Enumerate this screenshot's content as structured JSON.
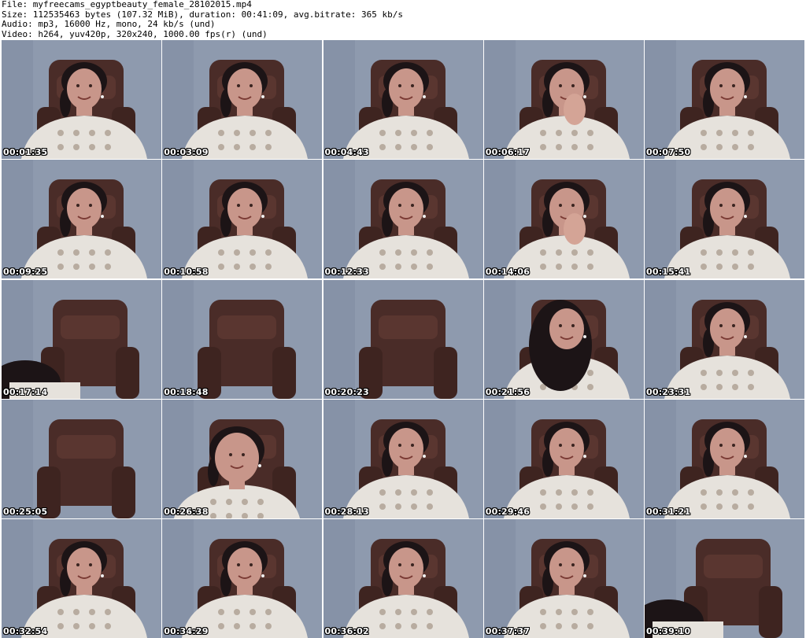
{
  "header": {
    "file_line": "File: myfreecams_egyptbeauty_female_28102015.mp4",
    "size_line": "Size: 112535463 bytes (107.32 MiB), duration: 00:41:09, avg.bitrate: 365 kb/s",
    "audio_line": "Audio: mp3, 16000 Hz, mono, 24 kb/s (und)",
    "video_line": "Video: h264, yuv420p, 320x240, 1000.00 fps(r) (und)"
  },
  "colors": {
    "wall": "#8e9aae",
    "chair": "#4a2c28",
    "skin": "#c8968a",
    "hair": "#1c1416",
    "shirt": "#e6e2dc",
    "timestamp_text": "#ffffff",
    "timestamp_outline": "#000000"
  },
  "thumbnails": [
    {
      "timestamp": "00:01:35",
      "scene": "person"
    },
    {
      "timestamp": "00:03:09",
      "scene": "person"
    },
    {
      "timestamp": "00:04:43",
      "scene": "person"
    },
    {
      "timestamp": "00:06:17",
      "scene": "person-hand"
    },
    {
      "timestamp": "00:07:50",
      "scene": "person"
    },
    {
      "timestamp": "00:09:25",
      "scene": "person"
    },
    {
      "timestamp": "00:10:58",
      "scene": "person"
    },
    {
      "timestamp": "00:12:33",
      "scene": "person"
    },
    {
      "timestamp": "00:14:06",
      "scene": "person-hand"
    },
    {
      "timestamp": "00:15:41",
      "scene": "person"
    },
    {
      "timestamp": "00:17:14",
      "scene": "chair-partial"
    },
    {
      "timestamp": "00:18:48",
      "scene": "chair"
    },
    {
      "timestamp": "00:20:23",
      "scene": "chair"
    },
    {
      "timestamp": "00:21:56",
      "scene": "person-hair-down"
    },
    {
      "timestamp": "00:23:31",
      "scene": "person"
    },
    {
      "timestamp": "00:25:05",
      "scene": "chair"
    },
    {
      "timestamp": "00:26:38",
      "scene": "person-close"
    },
    {
      "timestamp": "00:28:13",
      "scene": "person"
    },
    {
      "timestamp": "00:29:46",
      "scene": "person"
    },
    {
      "timestamp": "00:31:21",
      "scene": "person"
    },
    {
      "timestamp": "00:32:54",
      "scene": "person"
    },
    {
      "timestamp": "00:34:29",
      "scene": "person"
    },
    {
      "timestamp": "00:36:02",
      "scene": "person"
    },
    {
      "timestamp": "00:37:37",
      "scene": "person"
    },
    {
      "timestamp": "00:39:10",
      "scene": "chair-partial"
    }
  ]
}
